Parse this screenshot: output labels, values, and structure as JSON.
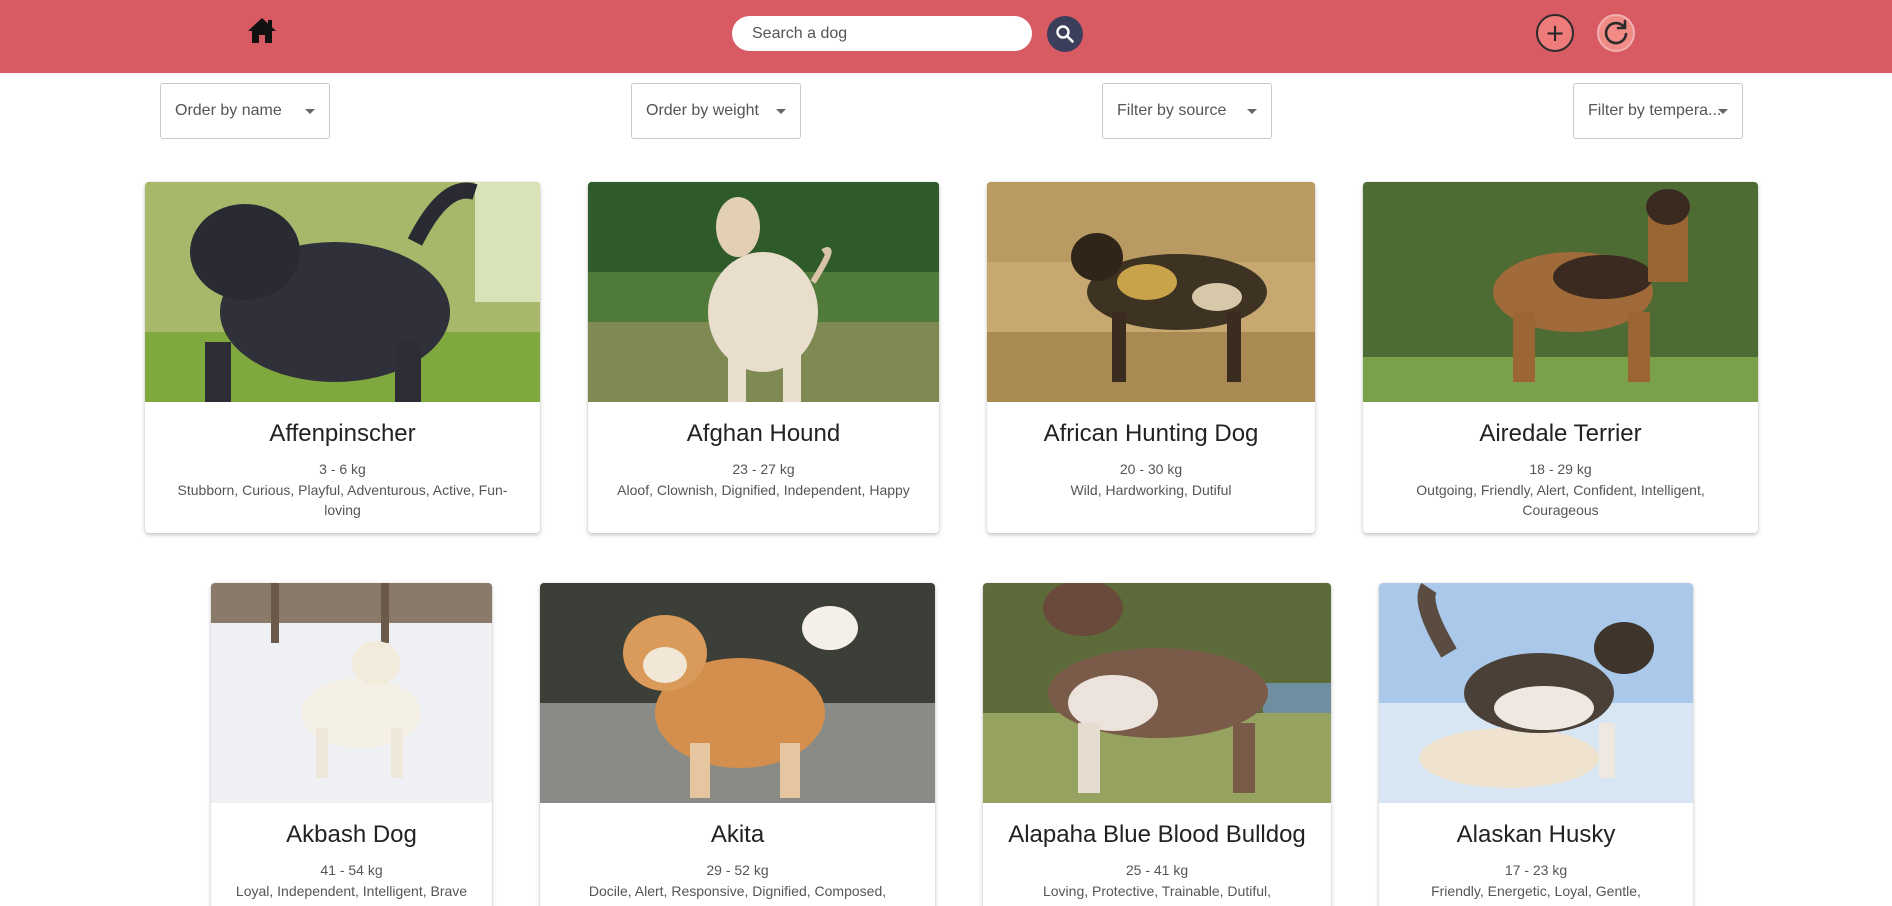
{
  "header": {
    "search_placeholder": "Search a dog",
    "home_icon": "home-icon",
    "search_icon": "search-icon",
    "add_icon": "plus-icon",
    "reload_icon": "refresh-icon"
  },
  "filters": {
    "order_name": "Order by name",
    "order_weight": "Order by weight",
    "source": "Filter by source",
    "temperament": "Filter by tempera..."
  },
  "colors": {
    "header": "#d85a62",
    "search_button": "#3b3f5c"
  },
  "dogs": [
    {
      "name": "Affenpinscher",
      "weight": "3 - 6 kg",
      "temperaments": "Stubborn, Curious, Playful, Adventurous, Active, Fun-loving"
    },
    {
      "name": "Afghan Hound",
      "weight": "23 - 27 kg",
      "temperaments": "Aloof, Clownish, Dignified, Independent, Happy"
    },
    {
      "name": "African Hunting Dog",
      "weight": "20 - 30 kg",
      "temperaments": "Wild, Hardworking, Dutiful"
    },
    {
      "name": "Airedale Terrier",
      "weight": "18 - 29 kg",
      "temperaments": "Outgoing, Friendly, Alert, Confident, Intelligent, Courageous"
    },
    {
      "name": "Akbash Dog",
      "weight": "41 - 54 kg",
      "temperaments": "Loyal, Independent, Intelligent, Brave"
    },
    {
      "name": "Akita",
      "weight": "29 - 52 kg",
      "temperaments": "Docile, Alert, Responsive, Dignified, Composed, Friendly, Receptive, Faithful, Courageous"
    },
    {
      "name": "Alapaha Blue Blood Bulldog",
      "weight": "25 - 41 kg",
      "temperaments": "Loving, Protective, Trainable, Dutiful, Responsible"
    },
    {
      "name": "Alaskan Husky",
      "weight": "17 - 23 kg",
      "temperaments": "Friendly, Energetic, Loyal, Gentle, Confident"
    }
  ]
}
